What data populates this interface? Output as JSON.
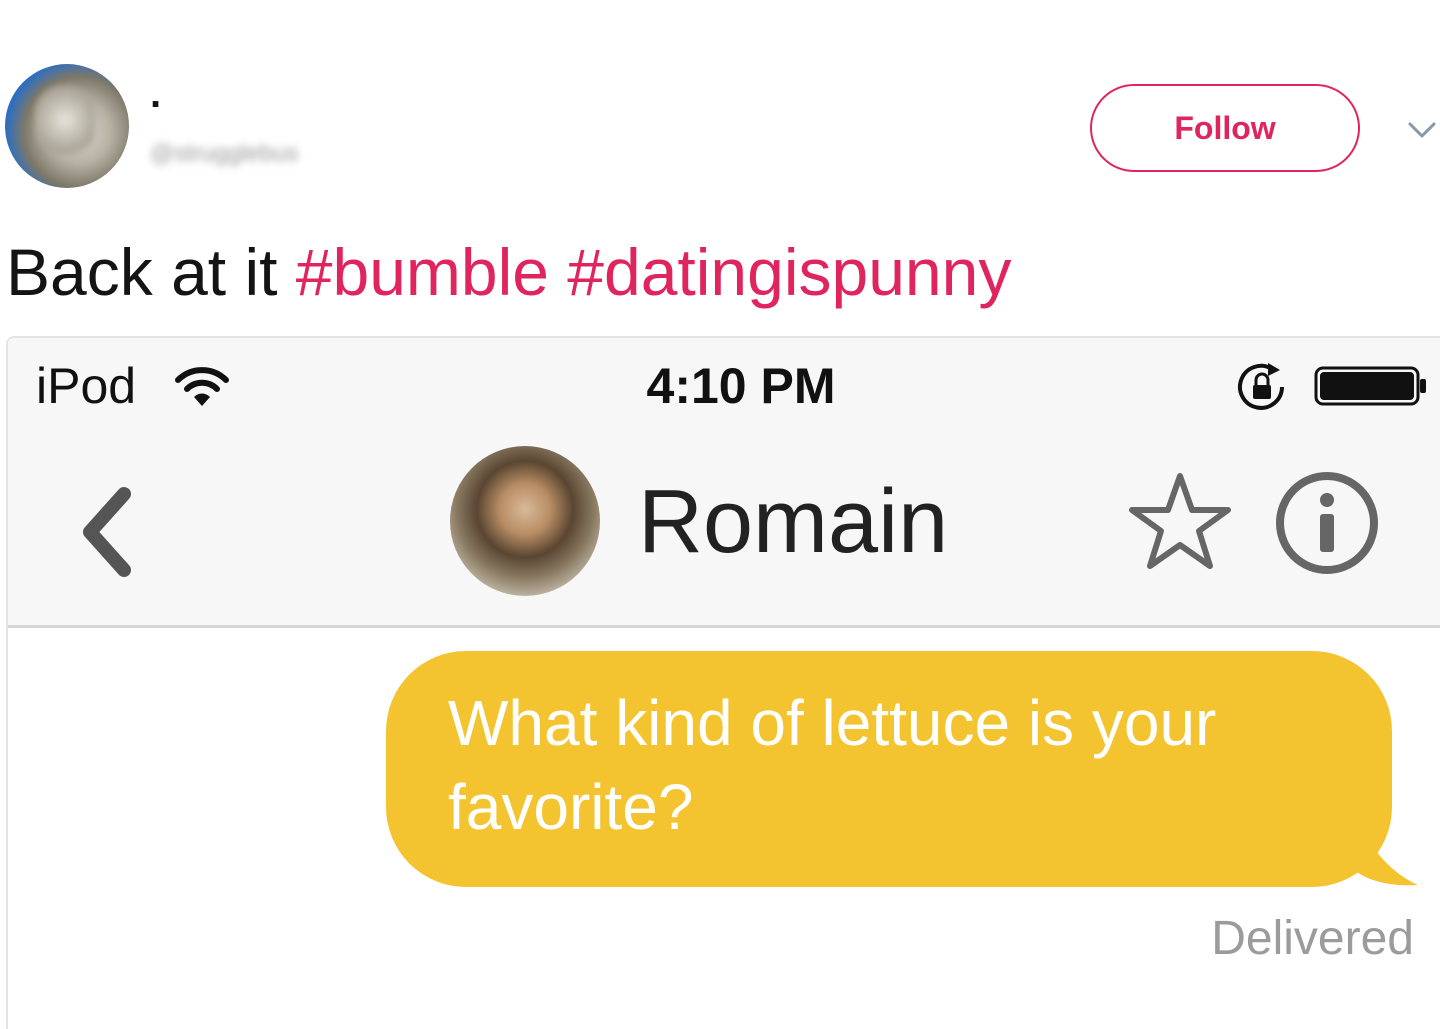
{
  "tweet": {
    "display_name": ".",
    "handle": "@strugglebus",
    "follow_label": "Follow",
    "text_plain": "Back at it ",
    "hashtags": [
      "#bumble",
      "#datingispunny"
    ],
    "accent_color": "#e0245e"
  },
  "screenshot": {
    "status_bar": {
      "carrier": "iPod",
      "time": "4:10 PM"
    },
    "nav": {
      "contact_name": "Romain"
    },
    "message": {
      "text": "What kind of lettuce is your favorite?",
      "bubble_color": "#f4c430",
      "status": "Delivered"
    }
  },
  "icons": [
    "chevron-down-icon",
    "wifi-icon",
    "rotation-lock-icon",
    "battery-icon",
    "back-chevron-icon",
    "star-icon",
    "info-icon"
  ]
}
